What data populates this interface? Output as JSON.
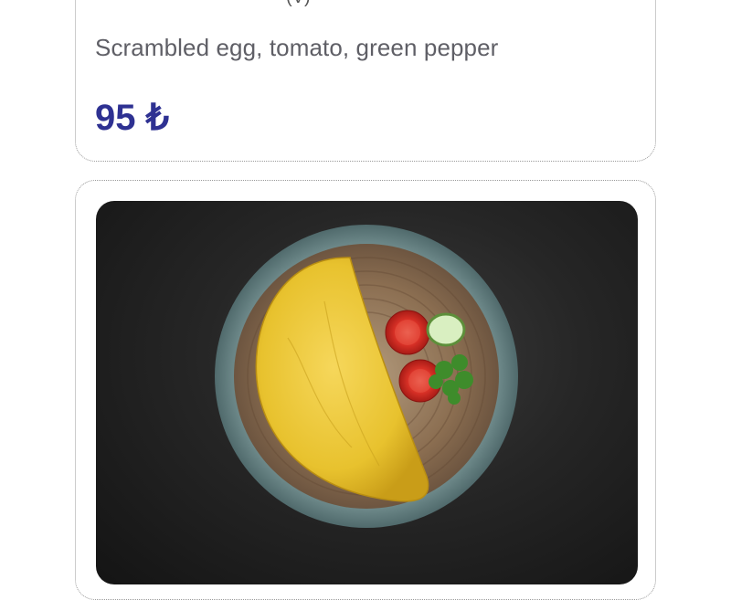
{
  "items": [
    {
      "title_fragment": "(V)",
      "description": "Scrambled egg, tomato, green pepper",
      "price": "95 ₺"
    },
    {
      "image": "omelette-plate-photo"
    }
  ],
  "colors": {
    "price": "#2e3192",
    "description": "#5f5f66",
    "card_border": "#9a9a9a",
    "photo_bg": "#1e1e1e"
  }
}
